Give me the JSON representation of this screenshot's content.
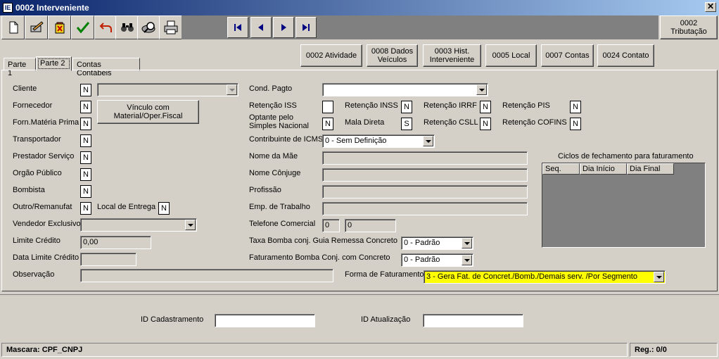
{
  "window": {
    "title": "0002 Interveniente",
    "close": "✕"
  },
  "toolbar": {
    "buttons": [
      "new",
      "edit",
      "delete",
      "confirm",
      "undo",
      "search",
      "print-preview",
      "print"
    ]
  },
  "nav": [
    "first",
    "prev",
    "next",
    "last"
  ],
  "tributacao_button": "0002\nTributação",
  "tabs": [
    "Parte 1",
    "Parte 2",
    "Contas Contábeis"
  ],
  "action_buttons": [
    "0002 Atividade",
    "0008 Dados\nVeículos",
    "0003 Hist.\nInterveniente",
    "0005 Local",
    "0007 Contas",
    "0024 Contato"
  ],
  "left": {
    "cliente": {
      "label": "Cliente",
      "value": "N"
    },
    "fornecedor": {
      "label": "Fornecedor",
      "value": "N"
    },
    "forn_materia": {
      "label": "Forn.Matéria Prima",
      "value": "N"
    },
    "transportador": {
      "label": "Transportador",
      "value": "N"
    },
    "prestador": {
      "label": "Prestador Serviço",
      "value": "N"
    },
    "orgao": {
      "label": "Orgão Público",
      "value": "N"
    },
    "bombista": {
      "label": "Bombista",
      "value": "N"
    },
    "outro": {
      "label": "Outro/Remanufat",
      "value": "N"
    },
    "local_entrega": {
      "label": "Local de Entrega",
      "value": "N"
    },
    "vinculo_button": "Vínculo com\nMaterial/Oper.Fiscal",
    "vendedor": {
      "label": "Vendedor Exclusivo",
      "value": ""
    },
    "limite": {
      "label": "Limite Crédito",
      "value": "0,00"
    },
    "data_limite": {
      "label": "Data Limite Crédito",
      "value": ""
    },
    "observacao": {
      "label": "Observação",
      "value": ""
    }
  },
  "middle": {
    "cond_pagto": {
      "label": "Cond. Pagto",
      "value": ""
    },
    "retencao_iss": {
      "label": "Retenção ISS",
      "value": ""
    },
    "retencao_inss": {
      "label": "Retenção INSS",
      "value": "N"
    },
    "retencao_irrf": {
      "label": "Retenção IRRF",
      "value": "N"
    },
    "retencao_pis": {
      "label": "Retenção PIS",
      "value": "N"
    },
    "optante": {
      "label": "Optante pelo\nSimples Nacional",
      "value": "N"
    },
    "mala_direta": {
      "label": "Mala Direta",
      "value": "S"
    },
    "retencao_csll": {
      "label": "Retenção CSLL",
      "value": "N"
    },
    "retencao_cofins": {
      "label": "Retenção COFINS",
      "value": "N"
    },
    "contribuinte": {
      "label": "Contribuinte de ICMS",
      "value": "0 - Sem Definição"
    },
    "nome_mae": {
      "label": "Nome da Mãe",
      "value": ""
    },
    "nome_conjuge": {
      "label": "Nome Cônjuge",
      "value": ""
    },
    "profissao": {
      "label": "Profissão",
      "value": ""
    },
    "emp_trabalho": {
      "label": "Emp. de Trabalho",
      "value": ""
    },
    "telefone": {
      "label": "Telefone Comercial",
      "ddd": "0",
      "numero": "0"
    },
    "taxa_bomba": {
      "label": "Taxa Bomba conj. Guia Remessa Concreto",
      "value": "0 - Padrão"
    },
    "fat_bomba": {
      "label": "Faturamento Bomba Conj. com Concreto",
      "value": "0 - Padrão"
    },
    "forma_fat": {
      "label": "Forma de Faturamento",
      "value": "3 - Gera Fat. de Concret./Bomb./Demais serv. /Por Segmento"
    }
  },
  "ciclos": {
    "title": "Ciclos de fechamento para faturamento",
    "columns": [
      "Seq.",
      "Dia Início",
      "Dia Final"
    ]
  },
  "footer": {
    "id_cadastramento": {
      "label": "ID Cadastramento",
      "value": ""
    },
    "id_atualizacao": {
      "label": "ID Atualização",
      "value": ""
    }
  },
  "status": {
    "mascara": "Mascara: CPF_CNPJ",
    "registro": "Reg.: 0/0"
  }
}
